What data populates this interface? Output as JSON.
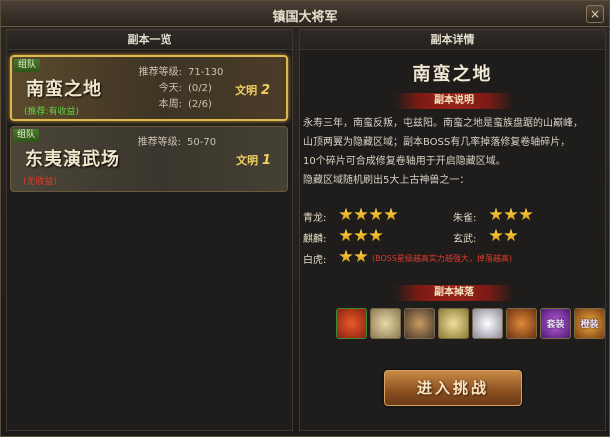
{
  "window": {
    "title": "镇国大将军",
    "close_label": "×"
  },
  "left_panel": {
    "header": "副本一览",
    "cards": [
      {
        "tag": "组队",
        "name": "南蛮之地",
        "note": "(推荐:有收益)",
        "rec_label": "推荐等级:",
        "rec_value": "71-130",
        "today_label": "今天:",
        "today_value": "(0/2)",
        "week_label": "本周:",
        "week_value": "(2/6)",
        "tier_text": "文明",
        "tier_num": "2",
        "selected": true
      },
      {
        "tag": "组队",
        "name": "东夷演武场",
        "note": "(无收益)",
        "rec_label": "推荐等级:",
        "rec_value": "50-70",
        "tier_text": "文明",
        "tier_num": "1",
        "selected": false
      }
    ]
  },
  "right_panel": {
    "header": "副本详情",
    "dungeon_name": "南蛮之地",
    "desc_title": "副本说明",
    "desc_lines": [
      "永寿三年，南蛮反叛，屯兹阳。南蛮之地是蛮族盘踞的山巅峰，",
      "山顶两翼为隐藏区域；副本BOSS有几率掉落修复卷轴碎片，",
      "10个碎片可合成修复卷轴用于开启隐藏区域。",
      "隐藏区域随机刷出5大上古神兽之一："
    ],
    "beasts": [
      {
        "name": "青龙:",
        "stars": 4
      },
      {
        "name": "朱雀:",
        "stars": 3
      },
      {
        "name": "麒麟:",
        "stars": 3
      },
      {
        "name": "玄武:",
        "stars": 2
      },
      {
        "name": "白虎:",
        "stars": 2
      }
    ],
    "boss_note": "(BOSS星级越高实力越强大，掉落越高)",
    "drops_title": "副本掉落",
    "drops": [
      {
        "icon": "red-gem-icon"
      },
      {
        "icon": "scroll-icon"
      },
      {
        "icon": "gear-parts-icon"
      },
      {
        "icon": "token-icon"
      },
      {
        "icon": "dice-icon"
      },
      {
        "icon": "orange-crystal-icon"
      },
      {
        "icon": "purple-equipment-icon",
        "label": "套装"
      },
      {
        "icon": "orange-equipment-icon",
        "label": "橙装"
      }
    ],
    "enter_button": "进入挑战"
  }
}
